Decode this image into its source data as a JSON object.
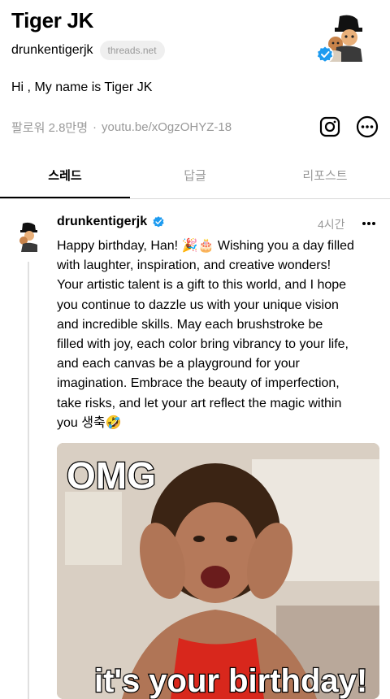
{
  "profile": {
    "name": "Tiger JK",
    "handle": "drunkentigerjk",
    "domain_badge": "threads.net",
    "bio": "Hi , My name is Tiger JK",
    "followers": "팔로워 2.8만명",
    "separator": "·",
    "link": "youtu.be/xOgzOHYZ-18"
  },
  "tabs": [
    {
      "label": "스레드",
      "active": true
    },
    {
      "label": "답글",
      "active": false
    },
    {
      "label": "리포스트",
      "active": false
    }
  ],
  "post": {
    "author": "drunkentigerjk",
    "time": "4시간",
    "text_lines": [
      "Happy birthday, Han! 🎉🎂 Wishing you a day filled",
      "with laughter, inspiration, and creative wonders!",
      "Your artistic talent is a gift to this world, and I hope",
      "you continue to dazzle us with your unique vision",
      "and incredible skills. May each brushstroke be",
      "filled with joy, each color bring vibrancy to your life,",
      "and each canvas be a playground for your",
      "imagination. Embrace the beauty of imperfection,",
      "take risks, and let your art reflect the magic within",
      "you 생축🤣"
    ],
    "image": {
      "top_caption": "OMG",
      "bottom_caption": "it's your birthday!"
    }
  },
  "icons": {
    "verified": "verified-badge-icon",
    "instagram": "instagram-icon",
    "more": "more-options-icon"
  },
  "colors": {
    "verified_blue": "#1d9bf0",
    "muted_text": "#999999",
    "pill_bg": "#efefef"
  }
}
